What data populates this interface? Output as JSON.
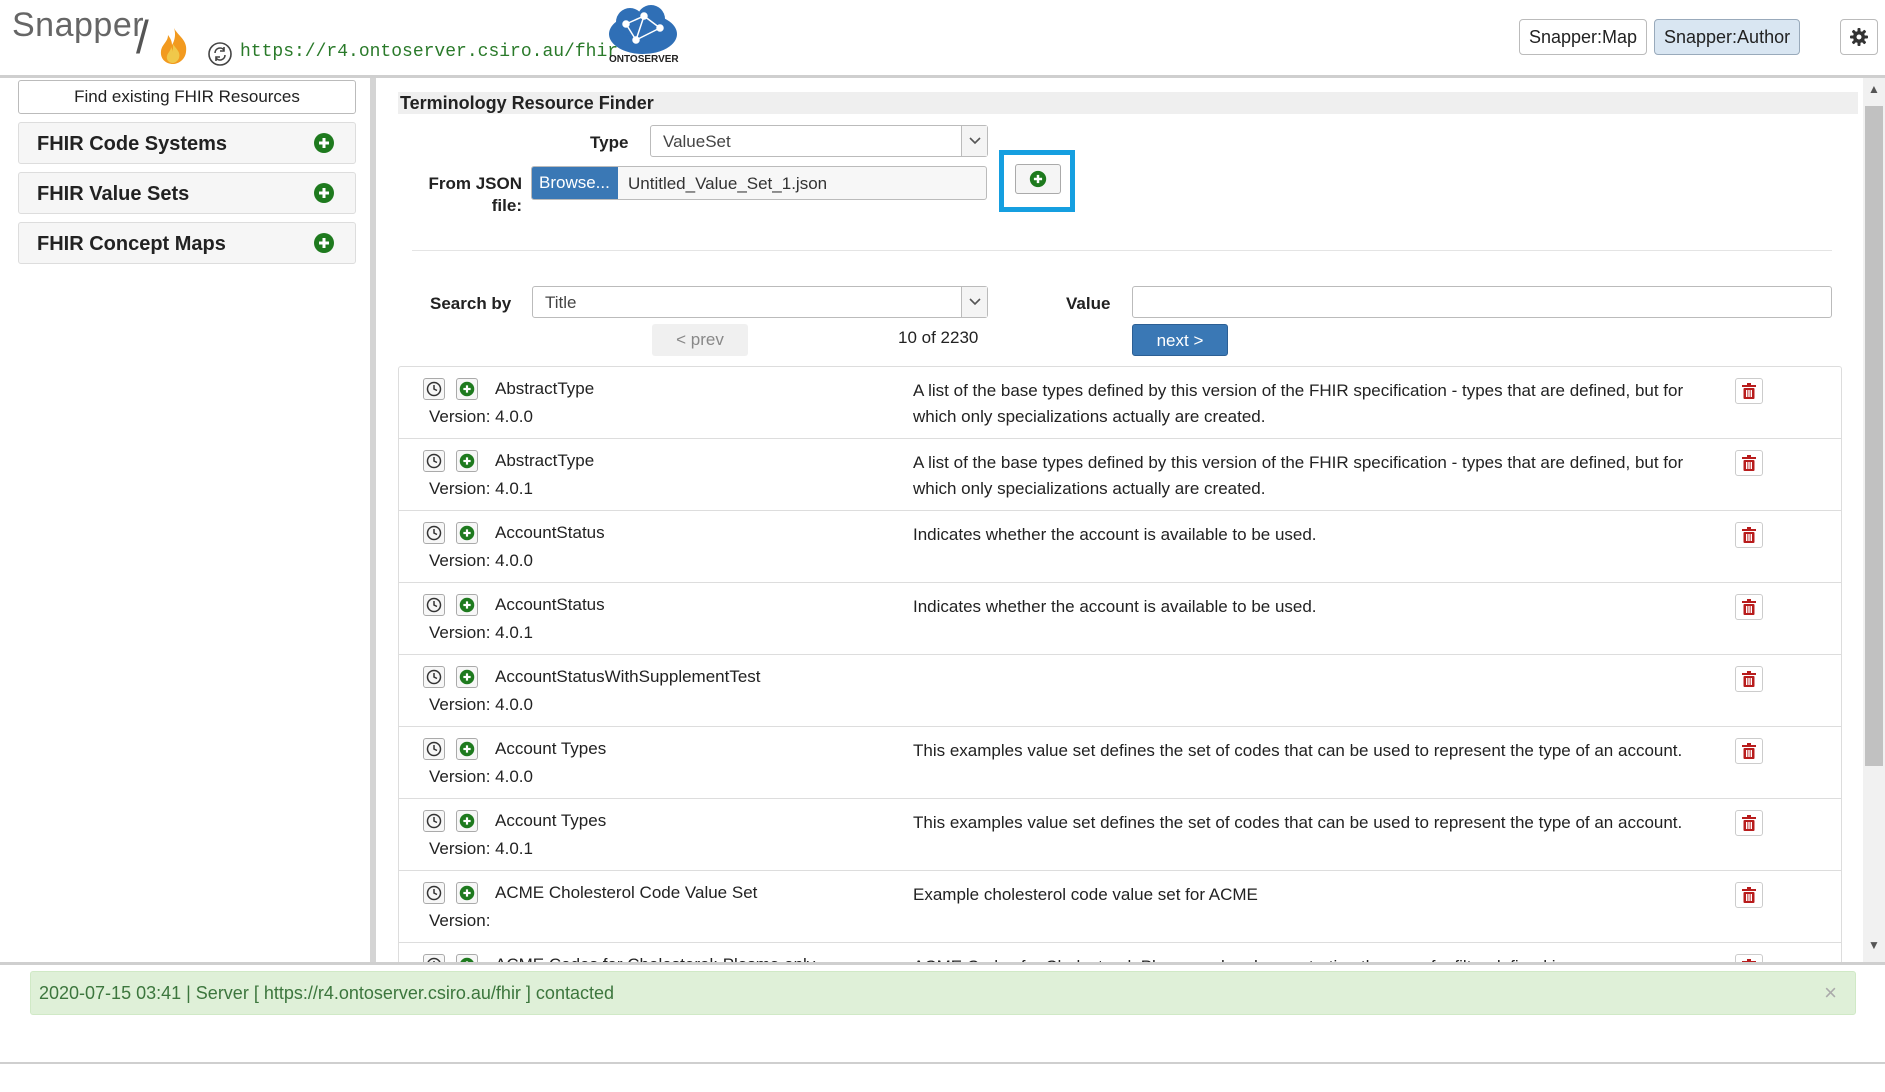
{
  "header": {
    "logo": "Snapper",
    "server_url": "https://r4.ontoserver.csiro.au/fhir",
    "ontoserver_label": "ONTOSERVER",
    "map_button": "Snapper:Map",
    "author_button": "Snapper:Author",
    "icons": [
      "flame-icon",
      "refresh-icon",
      "ontoserver-cloud-icon",
      "gear-icon"
    ]
  },
  "sidebar": {
    "find_button": "Find existing FHIR Resources",
    "items": [
      {
        "label": "FHIR Code Systems"
      },
      {
        "label": "FHIR Value Sets"
      },
      {
        "label": "FHIR Concept Maps"
      }
    ]
  },
  "finder": {
    "title": "Terminology Resource Finder",
    "type_label": "Type",
    "type_value": "ValueSet",
    "from_json_label_1": "From JSON",
    "from_json_label_2": "file:",
    "browse_label": "Browse...",
    "file_name": "Untitled_Value_Set_1.json",
    "search_by_label": "Search by",
    "search_by_value": "Title",
    "value_label": "Value",
    "value_input": "",
    "prev_label": "< prev",
    "next_label": "next >",
    "count": "10 of 2230"
  },
  "results": [
    {
      "name": "AbstractType",
      "version": "Version: 4.0.0",
      "description": "A list of the base types defined by this version of the FHIR specification - types that are defined, but for which only specializations actually are created."
    },
    {
      "name": "AbstractType",
      "version": "Version: 4.0.1",
      "description": "A list of the base types defined by this version of the FHIR specification - types that are defined, but for which only specializations actually are created."
    },
    {
      "name": "AccountStatus",
      "version": "Version: 4.0.0",
      "description": "Indicates whether the account is available to be used."
    },
    {
      "name": "AccountStatus",
      "version": "Version: 4.0.1",
      "description": "Indicates whether the account is available to be used."
    },
    {
      "name": "AccountStatusWithSupplementTest",
      "version": "Version: 4.0.0",
      "description": ""
    },
    {
      "name": "Account Types",
      "version": "Version: 4.0.0",
      "description": "This examples value set defines the set of codes that can be used to represent the type of an account."
    },
    {
      "name": "Account Types",
      "version": "Version: 4.0.1",
      "description": "This examples value set defines the set of codes that can be used to represent the type of an account."
    },
    {
      "name": "ACME Cholesterol Code Value Set",
      "version": "Version:",
      "description": "Example cholesterol code value set for ACME"
    },
    {
      "name": "ACME Codes for Cholesterol: Plasma only",
      "version": "",
      "description": "ACME Codes for Cholesterol: Plasma only - demonstrating the use of a filter defined in a"
    }
  ],
  "status": {
    "message": "2020-07-15 03:41 | Server [ https://r4.ontoserver.csiro.au/fhir ] contacted",
    "close": "×"
  },
  "colors": {
    "accent_blue": "#3a78b5",
    "highlight": "#159fe0",
    "green_plus": "#1e7a1e",
    "delete_red": "#b81c1c",
    "status_bg": "#dff0d8"
  }
}
